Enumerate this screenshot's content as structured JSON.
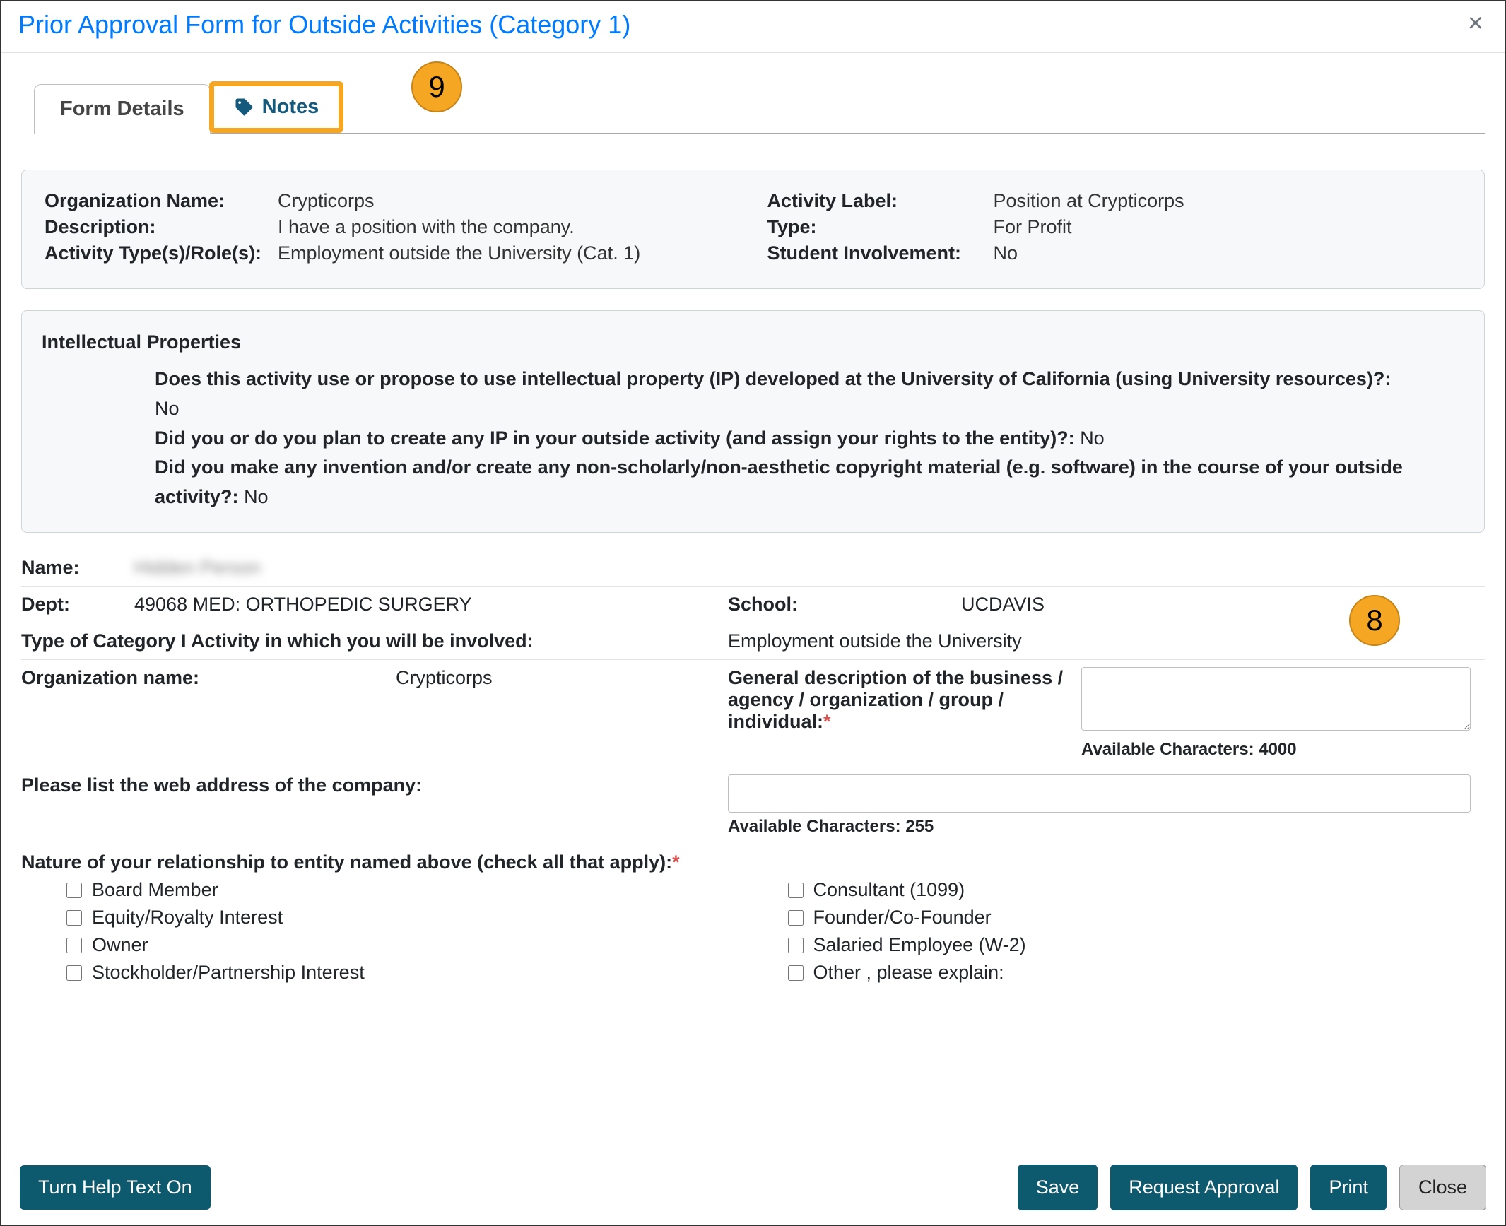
{
  "header": {
    "title": "Prior Approval Form for Outside Activities (Category 1)"
  },
  "tabs": {
    "form_details": "Form Details",
    "notes": "Notes"
  },
  "callouts": {
    "c9": "9",
    "c8": "8"
  },
  "summary": {
    "left": {
      "org_name_label": "Organization Name:",
      "org_name_value": "Crypticorps",
      "description_label": "Description:",
      "description_value": "I have a position with the company.",
      "activity_type_label": "Activity Type(s)/Role(s):",
      "activity_type_value": "Employment outside the University (Cat. 1)"
    },
    "right": {
      "activity_label_label": "Activity Label:",
      "activity_label_value": "Position at Crypticorps",
      "type_label": "Type:",
      "type_value": "For Profit",
      "student_label": "Student Involvement:",
      "student_value": "No"
    }
  },
  "ip": {
    "heading": "Intellectual Properties",
    "q1": "Does this activity use or propose to use intellectual property (IP) developed at the University of California (using University resources)?:",
    "a1": "No",
    "q2": "Did you or do you plan to create any IP in your outside activity (and assign your rights to the entity)?:",
    "a2": "No",
    "q3": "Did you make any invention and/or create any non-scholarly/non-aesthetic copyright material (e.g. software) in the course of your outside activity?:",
    "a3": "No"
  },
  "details": {
    "name_label": "Name:",
    "name_value": "Hidden Person",
    "dept_label": "Dept:",
    "dept_value": "49068 MED: ORTHOPEDIC SURGERY",
    "school_label": "School:",
    "school_value": "UCDAVIS",
    "cat_label": "Type of Category I Activity in which you will be involved:",
    "cat_value": "Employment outside the University",
    "org_label": "Organization name:",
    "org_value": "Crypticorps",
    "gen_desc_label_1": "General description of the business / agency / organization / group / individual:",
    "avail_4000": "Available Characters: 4000",
    "web_label": "Please list the web address of the company:",
    "avail_255": "Available Characters: 255",
    "nature_label": "Nature of your relationship to entity named above (check all that apply):"
  },
  "relationships": {
    "left": [
      "Board Member",
      "Equity/Royalty Interest",
      "Owner",
      "Stockholder/Partnership Interest"
    ],
    "right": [
      "Consultant (1099)",
      "Founder/Co-Founder",
      "Salaried Employee (W-2)",
      "Other , please explain:"
    ]
  },
  "footer": {
    "help": "Turn Help Text On",
    "save": "Save",
    "request": "Request Approval",
    "print": "Print",
    "close": "Close"
  }
}
